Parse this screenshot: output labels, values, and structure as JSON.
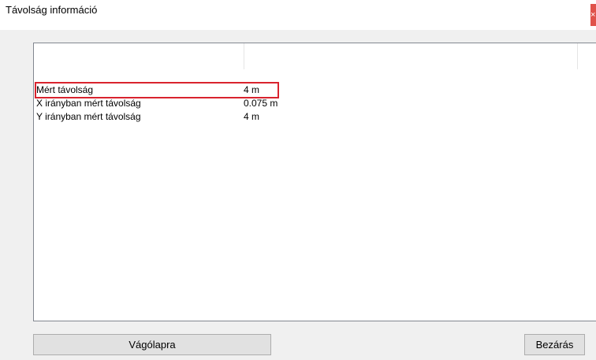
{
  "window": {
    "title": "Távolság információ",
    "close_glyph": "×"
  },
  "list": {
    "columns": [
      "",
      ""
    ],
    "rows": [
      {
        "name": "Mért távolság",
        "value": "4 m",
        "highlighted": true
      },
      {
        "name": "X irányban mért távolság",
        "value": "0.075 m",
        "highlighted": false
      },
      {
        "name": "Y irányban mért távolság",
        "value": "4 m",
        "highlighted": false
      }
    ]
  },
  "buttons": {
    "clipboard_label": "Vágólapra",
    "close_label": "Bezárás"
  },
  "colors": {
    "highlight_border": "#d9232e",
    "close_button": "#e0524a",
    "client_background": "#f0f0f0"
  }
}
